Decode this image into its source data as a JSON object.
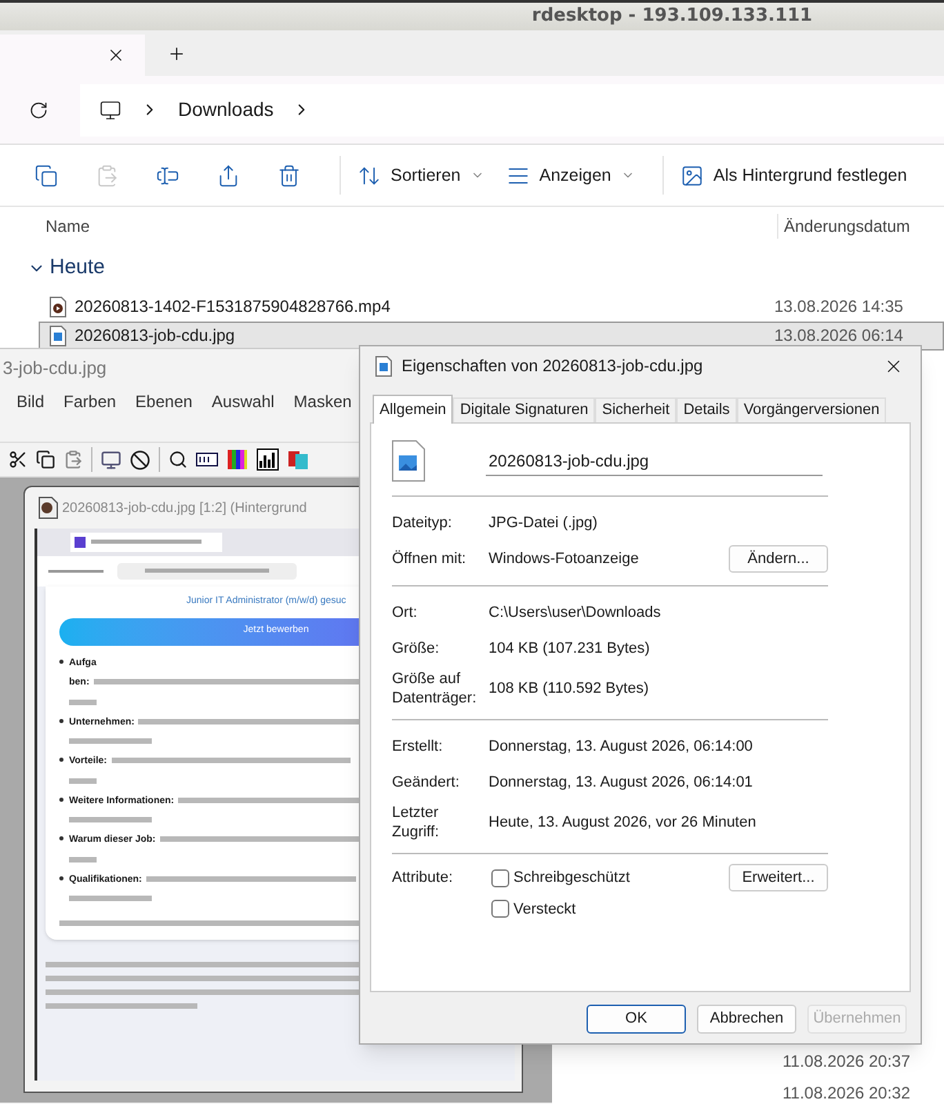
{
  "title_bar": {
    "title": "rdesktop - 193.109.133.111"
  },
  "explorer": {
    "breadcrumb": [
      "Downloads"
    ],
    "toolbar": [
      {
        "kind": "copy",
        "disabled": false
      },
      {
        "kind": "paste",
        "disabled": true
      },
      {
        "kind": "rename",
        "disabled": false
      },
      {
        "kind": "share",
        "disabled": false
      },
      {
        "kind": "delete",
        "disabled": false
      },
      {
        "kind": "sort",
        "label": "Sortieren",
        "disabled": false
      },
      {
        "kind": "view",
        "label": "Anzeigen",
        "disabled": false
      },
      {
        "kind": "wallpaper",
        "label": "Als Hintergrund festlegen",
        "disabled": false
      }
    ],
    "columns": [
      "Name",
      "Änderungsdatum"
    ],
    "groups": [
      {
        "label": "Heute",
        "expanded": true,
        "files": [
          {
            "name": "20260813-1402-F1531875904828766.mp4",
            "date": "13.08.2026 14:35",
            "kind": "video",
            "selected": false
          },
          {
            "name": "20260813-job-cdu.jpg",
            "date": "13.08.2026 06:14",
            "kind": "image",
            "selected": true
          }
        ]
      }
    ],
    "more_dates": [
      "11.08.2026 20:37",
      "11.08.2026 20:32"
    ]
  },
  "editor": {
    "title": "3-job-cdu.jpg",
    "menu": [
      "Bild",
      "Farben",
      "Ebenen",
      "Auswahl",
      "Masken"
    ],
    "image_window": {
      "title": "20260813-job-cdu.jpg [1:2] (Hintergrund",
      "page": {
        "heading": "Junior IT Administrator (m/w/d) gesuc",
        "button": "Jetzt bewerben",
        "bullets": [
          {
            "label": "Aufga",
            "wrap": "ben:"
          },
          {
            "label": "Unternehmen:"
          },
          {
            "label": "Vorteile:"
          },
          {
            "label": "Weitere Informationen:"
          },
          {
            "label": "Warum dieser Job:"
          },
          {
            "label": "Qualifikationen:"
          }
        ]
      }
    }
  },
  "dialog": {
    "title": "Eigenschaften von 20260813-job-cdu.jpg",
    "tabs": [
      {
        "label": "Allgemein",
        "selected": true
      },
      {
        "label": "Digitale Signaturen",
        "selected": false
      },
      {
        "label": "Sicherheit",
        "selected": false
      },
      {
        "label": "Details",
        "selected": false
      },
      {
        "label": "Vorgängerversionen",
        "selected": false
      }
    ],
    "filename": "20260813-job-cdu.jpg",
    "sections": [
      [
        {
          "label": "Dateityp:",
          "value": "JPG-Datei (.jpg)"
        },
        {
          "label": "Öffnen mit:",
          "value": "Windows-Fotoanzeige",
          "button": "Ändern..."
        }
      ],
      [
        {
          "label": "Ort:",
          "value": "C:\\Users\\user\\Downloads"
        },
        {
          "label": "Größe:",
          "value": "104 KB (107.231 Bytes)"
        },
        {
          "label": "Größe auf Datenträger:",
          "value": "108 KB (110.592 Bytes)"
        }
      ],
      [
        {
          "label": "Erstellt:",
          "value": "Donnerstag, 13. August 2026, 06:14:00"
        },
        {
          "label": "Geändert:",
          "value": "Donnerstag, 13. August 2026, 06:14:01"
        },
        {
          "label": "Letzter Zugriff:",
          "value": "Heute, 13. August 2026, vor 26 Minuten"
        }
      ]
    ],
    "attributes": {
      "label": "Attribute:",
      "checkboxes": [
        {
          "label": "Schreibgeschützt",
          "checked": false
        },
        {
          "label": "Versteckt",
          "checked": false
        }
      ],
      "button": "Erweitert..."
    },
    "buttons": [
      {
        "label": "OK",
        "default": true,
        "disabled": false
      },
      {
        "label": "Abbrechen",
        "default": false,
        "disabled": false
      },
      {
        "label": "Übernehmen",
        "default": false,
        "disabled": true
      }
    ]
  }
}
